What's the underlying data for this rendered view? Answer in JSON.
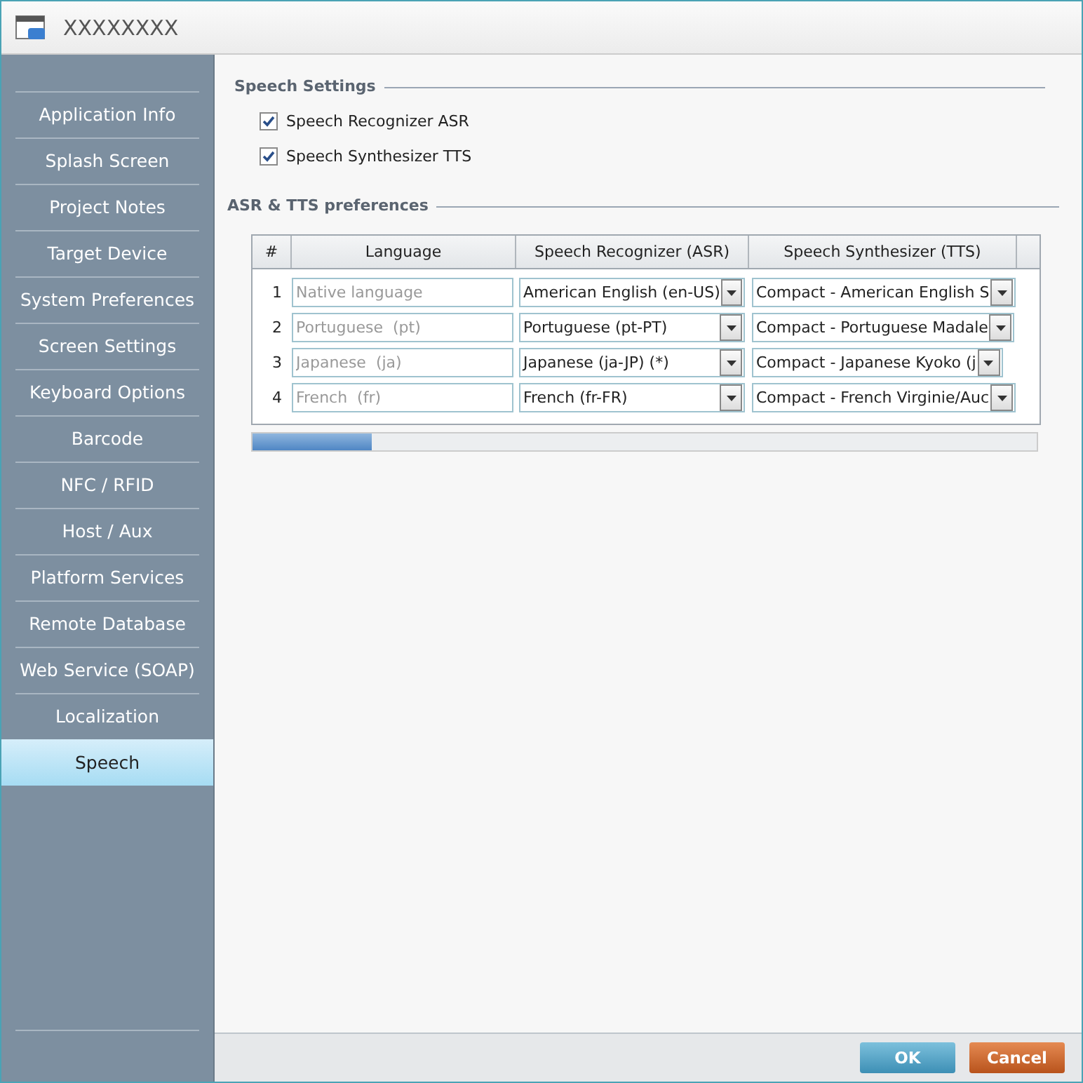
{
  "window": {
    "title": "XXXXXXXX"
  },
  "sidebar": {
    "items": [
      {
        "label": "Application Info",
        "selected": false
      },
      {
        "label": "Splash Screen",
        "selected": false
      },
      {
        "label": "Project Notes",
        "selected": false
      },
      {
        "label": "Target Device",
        "selected": false
      },
      {
        "label": "System Preferences",
        "selected": false
      },
      {
        "label": "Screen Settings",
        "selected": false
      },
      {
        "label": "Keyboard Options",
        "selected": false
      },
      {
        "label": "Barcode",
        "selected": false
      },
      {
        "label": "NFC / RFID",
        "selected": false
      },
      {
        "label": "Host / Aux",
        "selected": false
      },
      {
        "label": "Platform Services",
        "selected": false
      },
      {
        "label": "Remote Database",
        "selected": false
      },
      {
        "label": "Web Service (SOAP)",
        "selected": false
      },
      {
        "label": "Localization",
        "selected": false
      },
      {
        "label": "Speech",
        "selected": true
      }
    ]
  },
  "speech_settings": {
    "title": "Speech Settings",
    "options": [
      {
        "label": "Speech Recognizer ASR",
        "checked": true
      },
      {
        "label": "Speech Synthesizer TTS",
        "checked": true
      }
    ]
  },
  "preferences": {
    "title": "ASR & TTS preferences",
    "table": {
      "columns": [
        "#",
        "Language",
        "Speech Recognizer (ASR)",
        "Speech Synthesizer (TTS)"
      ],
      "rows": [
        {
          "number": "1",
          "language_placeholder": "Native language",
          "asr": "American English (en-US)",
          "tts": "Compact - American English S"
        },
        {
          "number": "2",
          "language_placeholder": "Portuguese  (pt)",
          "asr": "Portuguese (pt-PT)",
          "tts": "Compact - Portuguese Madale"
        },
        {
          "number": "3",
          "language_placeholder": "Japanese  (ja)",
          "asr": "Japanese (ja-JP) (*)",
          "tts": "Compact - Japanese Kyoko (j"
        },
        {
          "number": "4",
          "language_placeholder": "French  (fr)",
          "asr": "French (fr-FR)",
          "tts": "Compact - French Virginie/Auc"
        }
      ]
    }
  },
  "buttons": [
    {
      "label": "OK",
      "kind": "primary"
    },
    {
      "label": "Cancel",
      "kind": "cancel"
    }
  ]
}
